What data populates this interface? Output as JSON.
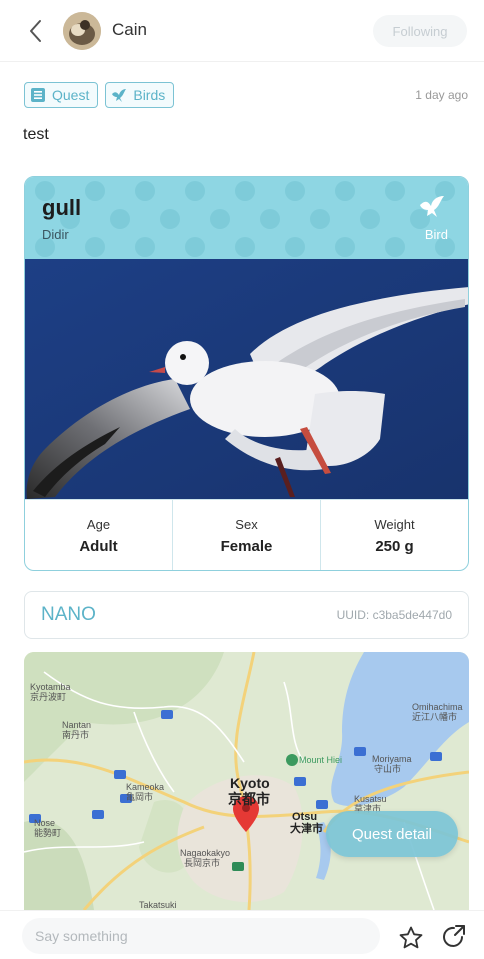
{
  "header": {
    "username": "Cain",
    "follow_label": "Following"
  },
  "post": {
    "tags": [
      {
        "label": "Quest",
        "icon": "list-icon"
      },
      {
        "label": "Birds",
        "icon": "bird-icon"
      }
    ],
    "time": "1 day ago",
    "text": "test"
  },
  "bird_card": {
    "name": "gull",
    "subtitle": "Didir",
    "type_label": "Bird",
    "stats": [
      {
        "label": "Age",
        "value": "Adult"
      },
      {
        "label": "Sex",
        "value": "Female"
      },
      {
        "label": "Weight",
        "value": "250 g"
      }
    ]
  },
  "nano": {
    "label": "NANO",
    "uuid": "UUID: c3ba5de447d0"
  },
  "map": {
    "labels": {
      "kyoto_en": "Kyoto",
      "kyoto_jp": "京都市",
      "kameoka": "Kameoka",
      "kameoka_jp": "亀岡市",
      "nantan": "Nantan",
      "nantan_jp": "南丹市",
      "otsu": "Otsu",
      "otsu_jp": "大津市",
      "moriyama": "Moriyama",
      "moriyama_jp": "守山市",
      "kusatsu": "Kusatsu",
      "kusatsu_jp": "草津市",
      "omihachiman": "Omihachima",
      "omihachiman_jp": "近江八幡市",
      "nagaokakyo": "Nagaokakyo",
      "nagaokakyo_jp": "長岡京市",
      "nose": "Nose",
      "nose_jp": "能勢町",
      "kyotamba": "Kyotamba",
      "kyotamba_jp": "京丹波町",
      "mount_hiei": "Mount Hiei",
      "takatsuki": "Takatsuki"
    },
    "quest_button": "Quest detail"
  },
  "bottom": {
    "comment_placeholder": "Say something"
  },
  "colors": {
    "accent": "#5cb3c8",
    "card_header": "#8ed6e3",
    "pin": "#e53935"
  }
}
